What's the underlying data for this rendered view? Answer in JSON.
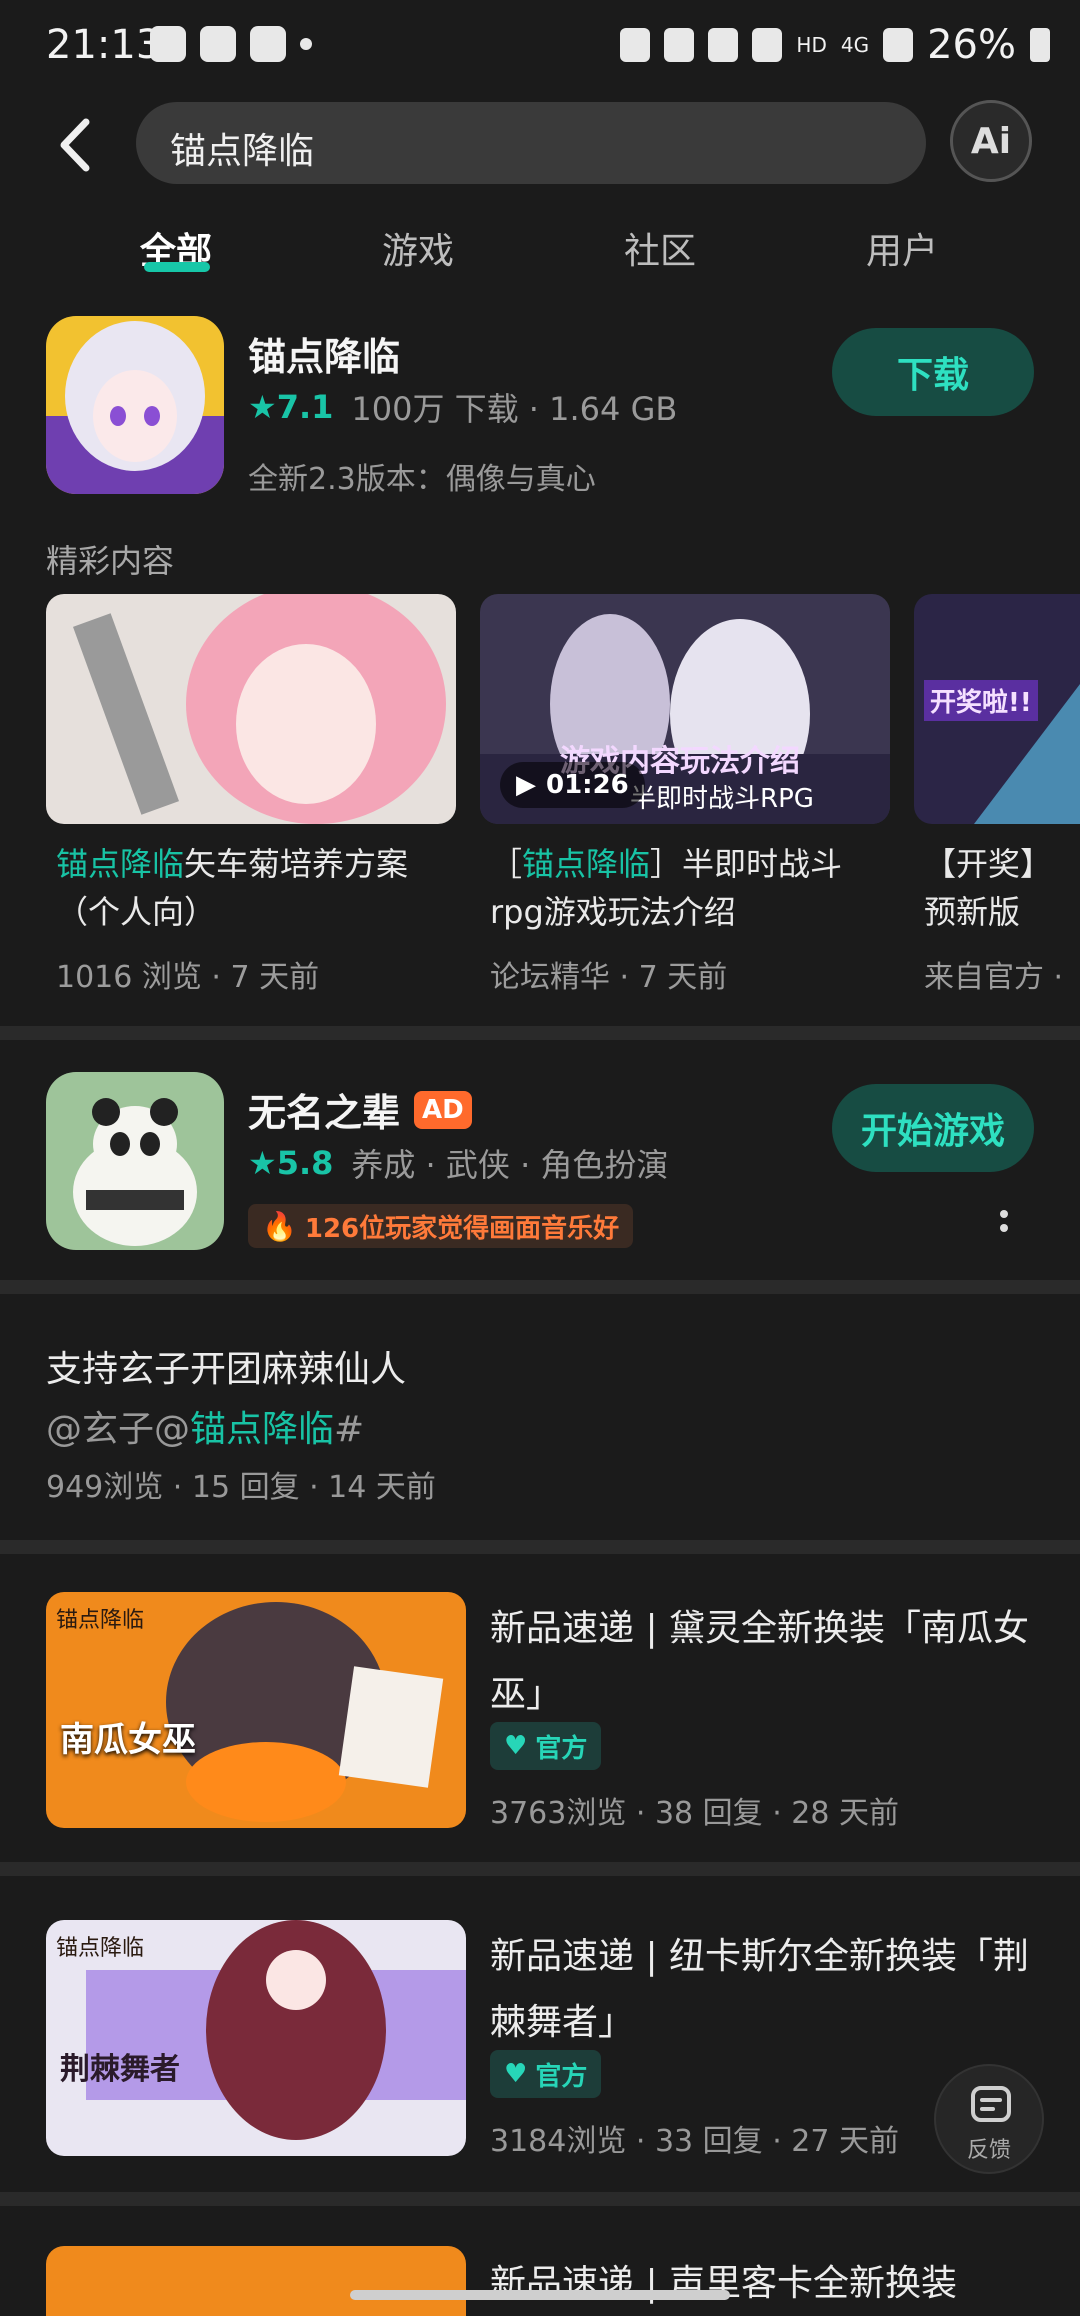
{
  "status_bar": {
    "time": "21:13",
    "hd": "HD",
    "net": "4G",
    "battery": "26%"
  },
  "search": {
    "query": "锚点降临",
    "ai_label": "Ai"
  },
  "tabs": [
    {
      "label": "全部",
      "active": true
    },
    {
      "label": "游戏",
      "active": false
    },
    {
      "label": "社区",
      "active": false
    },
    {
      "label": "用户",
      "active": false
    }
  ],
  "app1": {
    "name": "锚点降临",
    "rating": "7.1",
    "stats": "100万 下载 · 1.64 GB",
    "subtitle": "全新2.3版本：偶像与真心",
    "button": "下载"
  },
  "highlights": {
    "label": "精彩内容",
    "items": [
      {
        "title_accent": "锚点降临",
        "title_rest": "矢车菊培养方案（个人向）",
        "meta": "1016 浏览 · 7 天前"
      },
      {
        "title_prefix": "［",
        "title_accent": "锚点降临",
        "title_rest": "］半即时战斗rpg游戏玩法介绍",
        "meta": "论坛精华 · 7 天前",
        "overlay_title": "游戏内容玩法介绍",
        "overlay_sub": "半即时战斗RPG",
        "duration": "01:26"
      },
      {
        "title_rest": "【开奖】预新版本，转",
        "meta": "来自官方 ·",
        "overlay_title": "开奖啦!!"
      }
    ]
  },
  "app2": {
    "name": "无名之辈",
    "ad": "AD",
    "rating": "5.8",
    "tags": "养成 · 武侠 · 角色扮演",
    "hint": "126位玩家觉得画面音乐好",
    "button": "开始游戏"
  },
  "post1": {
    "title": "支持玄子开团麻辣仙人",
    "line2_prefix": "@玄子@",
    "line2_accent": "锚点降临",
    "line2_suffix": "#",
    "meta": "949浏览 · 15 回复 · 14 天前"
  },
  "post2": {
    "title": "新品速递 | 黛灵全新换装「南瓜女巫」",
    "badge": "官方",
    "meta": "3763浏览 · 38 回复 · 28 天前",
    "thumb_text": "南瓜女巫",
    "thumb_logo": "锚点降临"
  },
  "post3": {
    "title": "新品速递 | 纽卡斯尔全新换装「荆棘舞者」",
    "badge": "官方",
    "meta": "3184浏览 · 33 回复 · 27 天前",
    "thumb_text": "荆棘舞者",
    "thumb_logo": "锚点降临"
  },
  "post4": {
    "title_partial": "新品速递 | 声里客卡全新换装"
  },
  "feedback": {
    "label": "反馈"
  }
}
